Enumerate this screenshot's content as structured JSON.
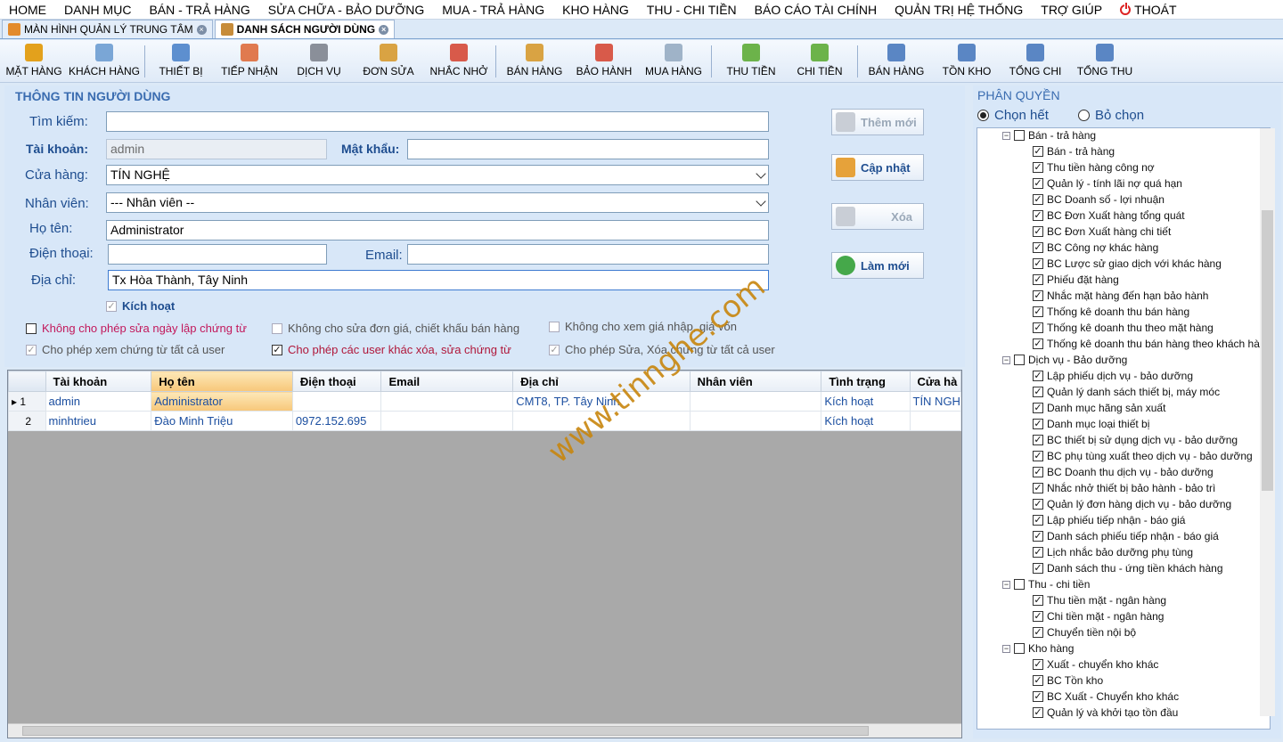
{
  "menu": [
    "HOME",
    "DANH MỤC",
    "BÁN - TRẢ HÀNG",
    "SỬA CHỮA - BẢO DƯỠNG",
    "MUA - TRẢ HÀNG",
    "KHO HÀNG",
    "THU - CHI TIỀN",
    "BÁO CÁO TÀI CHÍNH",
    "QUẢN TRỊ HỆ THỐNG",
    "TRỢ GIÚP"
  ],
  "menu_exit": "THOÁT",
  "tabs": [
    "MÀN HÌNH QUẢN LÝ TRUNG TÂM",
    "DANH SÁCH NGƯỜI DÙNG"
  ],
  "toolbar": [
    "MẶT HÀNG",
    "KHÁCH HÀNG",
    "THIẾT BỊ",
    "TIẾP NHẬN",
    "DỊCH VỤ",
    "ĐƠN SỬA",
    "NHẮC NHỞ",
    "BÁN HÀNG",
    "BẢO HÀNH",
    "MUA HÀNG",
    "THU TIỀN",
    "CHI TIỀN",
    "BÁN HÀNG",
    "TỒN KHO",
    "TỔNG CHI",
    "TỔNG THU"
  ],
  "form": {
    "legend": "THÔNG TIN NGƯỜI DÙNG",
    "search_label": "Tìm kiếm:",
    "search_value": "",
    "account_label": "Tài khoản:",
    "account_value": "admin",
    "password_label": "Mật khẩu:",
    "password_value": "",
    "store_label": "Cửa hàng:",
    "store_value": "TÍN NGHỆ",
    "staff_label": "Nhân viên:",
    "staff_value": "--- Nhân viên --",
    "name_label": "Họ tên:",
    "name_value": "Administrator",
    "phone_label": "Điện thoại:",
    "phone_value": "",
    "email_label": "Email:",
    "email_value": "",
    "address_label": "Địa chỉ:",
    "address_value": "Tx Hòa Thành, Tây Ninh",
    "active_label": "Kích hoạt",
    "options": [
      "Không cho phép sửa ngày lập chứng từ",
      "Không cho sửa đơn giá, chiết khấu bán hàng",
      "Không cho xem giá nhập, giá vốn",
      "Cho phép xem chứng từ tất cả user",
      "Cho phép các user khác xóa, sửa chứng từ",
      "Cho phép Sửa, Xóa chứng từ tất cả user"
    ]
  },
  "buttons": {
    "add": "Thêm mới",
    "update": "Cập nhật",
    "delete": "Xóa",
    "refresh": "Làm mới"
  },
  "grid": {
    "columns": [
      "Tài khoản",
      "Họ tên",
      "Điện thoại",
      "Email",
      "Địa chỉ",
      "Nhân viên",
      "Tình trạng",
      "Cửa hà"
    ],
    "rows": [
      [
        "1",
        "admin",
        "Administrator",
        "",
        "",
        "CMT8, TP. Tây Ninh",
        "",
        "Kích hoạt",
        "TÍN NGH"
      ],
      [
        "2",
        "minhtrieu",
        "Đào Minh Triệu",
        "0972.152.695",
        "",
        "",
        "",
        "Kích hoạt",
        ""
      ]
    ]
  },
  "perm": {
    "legend": "PHÂN QUYỀN",
    "select_all": "Chọn hết",
    "deselect": "Bỏ chọn",
    "groups": [
      {
        "name": "Bán - trả hàng",
        "items": [
          "Bán - trả hàng",
          "Thu tiền hàng công nợ",
          "Quản lý - tính lãi nợ quá hạn",
          "BC Doanh số - lợi nhuận",
          "BC Đơn Xuất hàng tổng quát",
          "BC Đơn Xuất hàng chi tiết",
          "BC Công nợ khác hàng",
          "BC Lược sử giao dịch với khác hàng",
          "Phiếu đặt hàng",
          "Nhắc mặt hàng đến hạn bảo hành",
          "Thống kê doanh thu bán hàng",
          "Thống kê doanh thu theo mặt hàng",
          "Thống kê doanh thu bán hàng theo khách hà"
        ]
      },
      {
        "name": "Dịch vụ - Bảo dưỡng",
        "items": [
          "Lập phiếu dịch vụ - bảo dưỡng",
          "Quản lý danh sách thiết bị, máy móc",
          "Danh mục hãng sản xuất",
          "Danh mục loại thiết bị",
          "BC thiết bị sử dụng dịch vụ - bảo dưỡng",
          "BC phụ tùng xuất theo dịch vụ - bảo dưỡng",
          "BC Doanh thu dịch vụ - bảo dưỡng",
          "Nhắc nhở thiết bị bảo hành - bảo trì",
          "Quản lý đơn hàng dịch vụ - bảo dưỡng",
          "Lập phiếu tiếp nhận - báo giá",
          "Danh sách phiếu tiếp nhận - báo giá",
          "Lịch nhắc bảo dưỡng phụ tùng",
          "Danh sách thu - ứng tiền khách hàng"
        ]
      },
      {
        "name": "Thu - chi tiền",
        "items": [
          "Thu tiền mặt - ngân hàng",
          "Chi tiền mặt - ngân hàng",
          "Chuyển tiền nội bộ"
        ]
      },
      {
        "name": "Kho hàng",
        "items": [
          "Xuất - chuyển kho khác",
          "BC Tồn kho",
          "BC Xuất - Chuyển kho khác",
          "Quản lý và khởi tạo tồn đầu"
        ]
      }
    ]
  },
  "watermark": "www.tinnghe.com"
}
